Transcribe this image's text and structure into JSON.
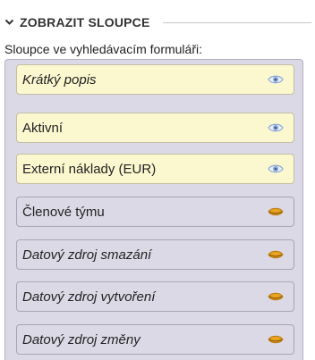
{
  "section": {
    "title": "ZOBRAZIT SLOUPCE",
    "toggle_icon": "chevron-down-icon"
  },
  "field": {
    "label": "Sloupce ve vyhledávacím formuláři:"
  },
  "colors": {
    "visible_item_bg": "#fbf8d0",
    "hidden_item_bg": "#dcd9e6",
    "list_bg": "#dcd9e6",
    "eye_visible": "#8aa6d6",
    "eye_hidden": "#e8a321"
  },
  "columns": [
    {
      "label": "Krátký popis",
      "italic": true,
      "visible": true,
      "icon": "eye-open-icon"
    },
    {
      "label": "Aktivní",
      "italic": false,
      "visible": true,
      "icon": "eye-open-icon"
    },
    {
      "label": "Externí náklady (EUR)",
      "italic": false,
      "visible": true,
      "icon": "eye-open-icon"
    },
    {
      "label": "Členové týmu",
      "italic": false,
      "visible": false,
      "icon": "eye-closed-icon"
    },
    {
      "label": "Datový zdroj smazání",
      "italic": true,
      "visible": false,
      "icon": "eye-closed-icon"
    },
    {
      "label": "Datový zdroj vytvoření",
      "italic": true,
      "visible": false,
      "icon": "eye-closed-icon"
    },
    {
      "label": "Datový zdroj změny",
      "italic": true,
      "visible": false,
      "icon": "eye-closed-icon"
    }
  ]
}
